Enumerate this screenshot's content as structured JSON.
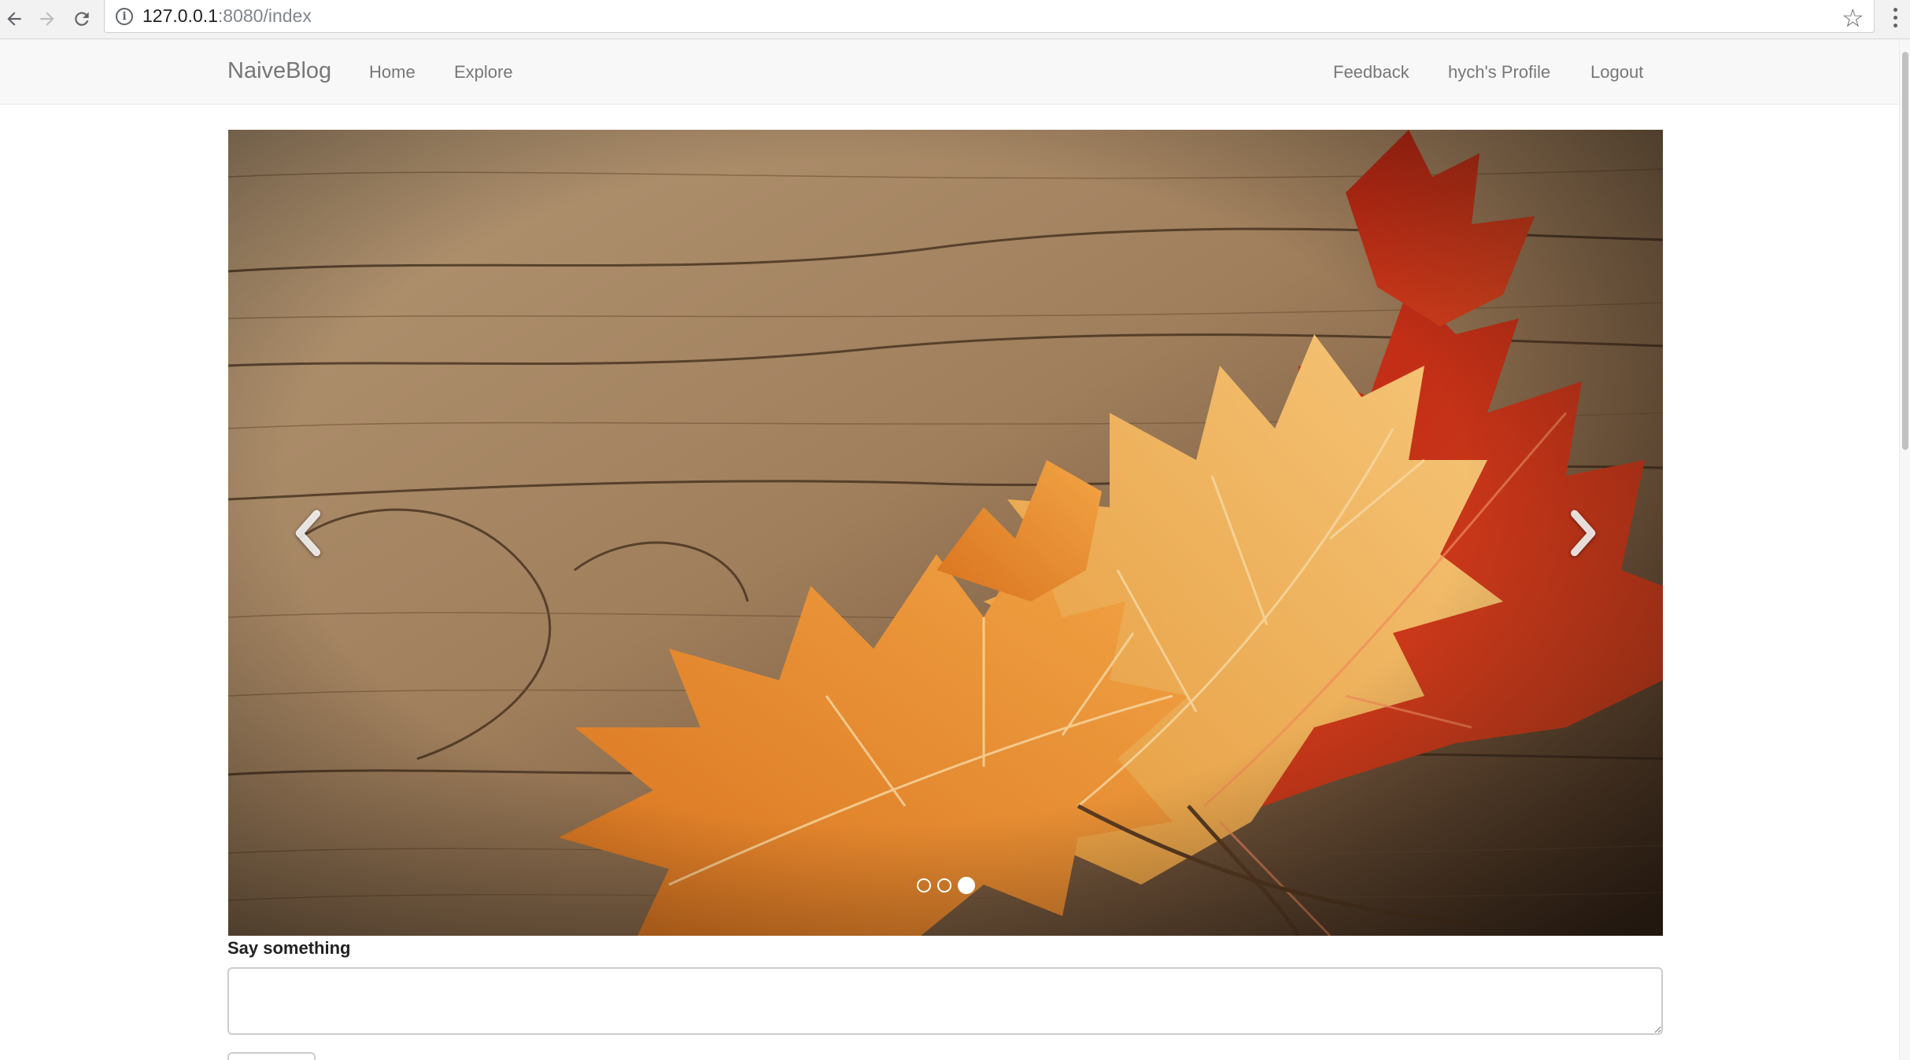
{
  "browser": {
    "url_host": "127.0.0.1",
    "url_rest": ":8080/index"
  },
  "navbar": {
    "brand": "NaiveBlog",
    "left_links": [
      "Home",
      "Explore"
    ],
    "right_links": [
      "Feedback",
      "hych's Profile",
      "Logout"
    ]
  },
  "carousel": {
    "slide_count": 3,
    "active_index": 2,
    "colors": {
      "wood": "#9b7a58",
      "leaf_orange": "#e8912f",
      "leaf_yellow": "#f0b458",
      "leaf_red": "#c0321a"
    }
  },
  "form": {
    "label": "Say something",
    "input_value": "",
    "input_placeholder": ""
  }
}
